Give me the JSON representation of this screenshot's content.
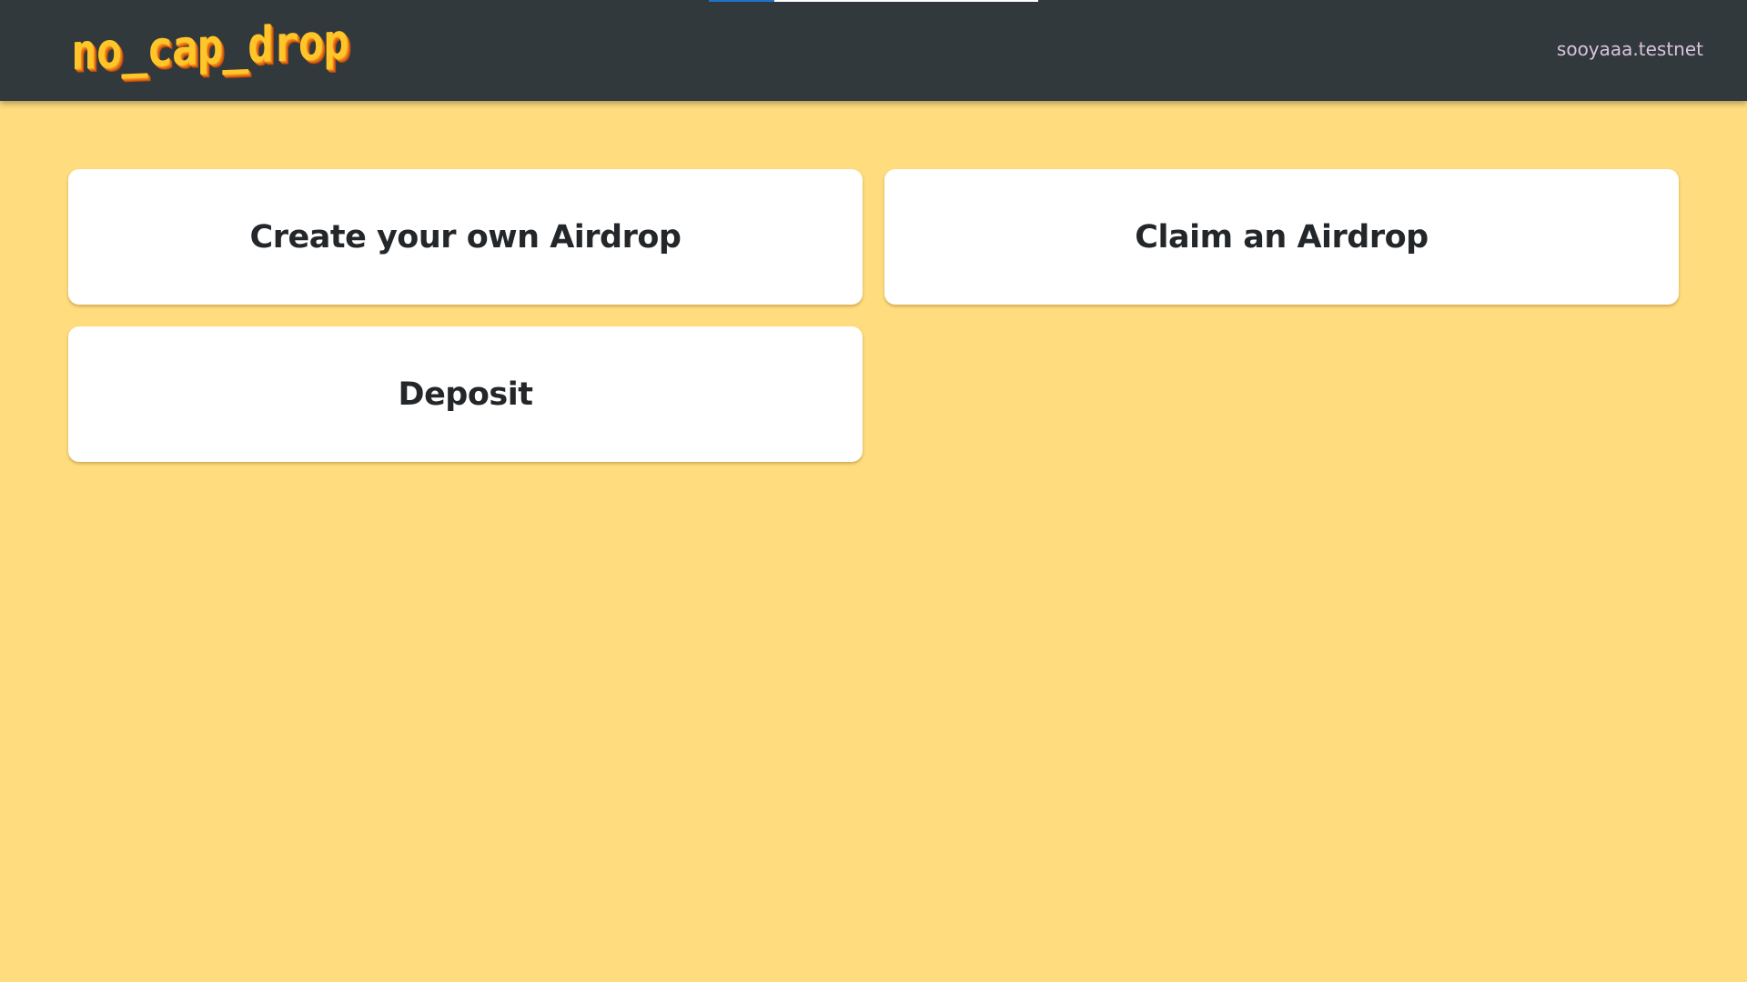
{
  "app": {
    "logo_text": "no_cap_drop",
    "account": "sooyaaa.testnet",
    "loading_progress": 0.2
  },
  "cards": [
    {
      "label": "Create your own Airdrop"
    },
    {
      "label": "Claim an Airdrop"
    },
    {
      "label": "Deposit"
    }
  ],
  "colors": {
    "background": "#ffdc7e",
    "header": "#32393c",
    "card": "#ffffff",
    "logo": "#ffc629",
    "progress": "#1f74c9"
  }
}
